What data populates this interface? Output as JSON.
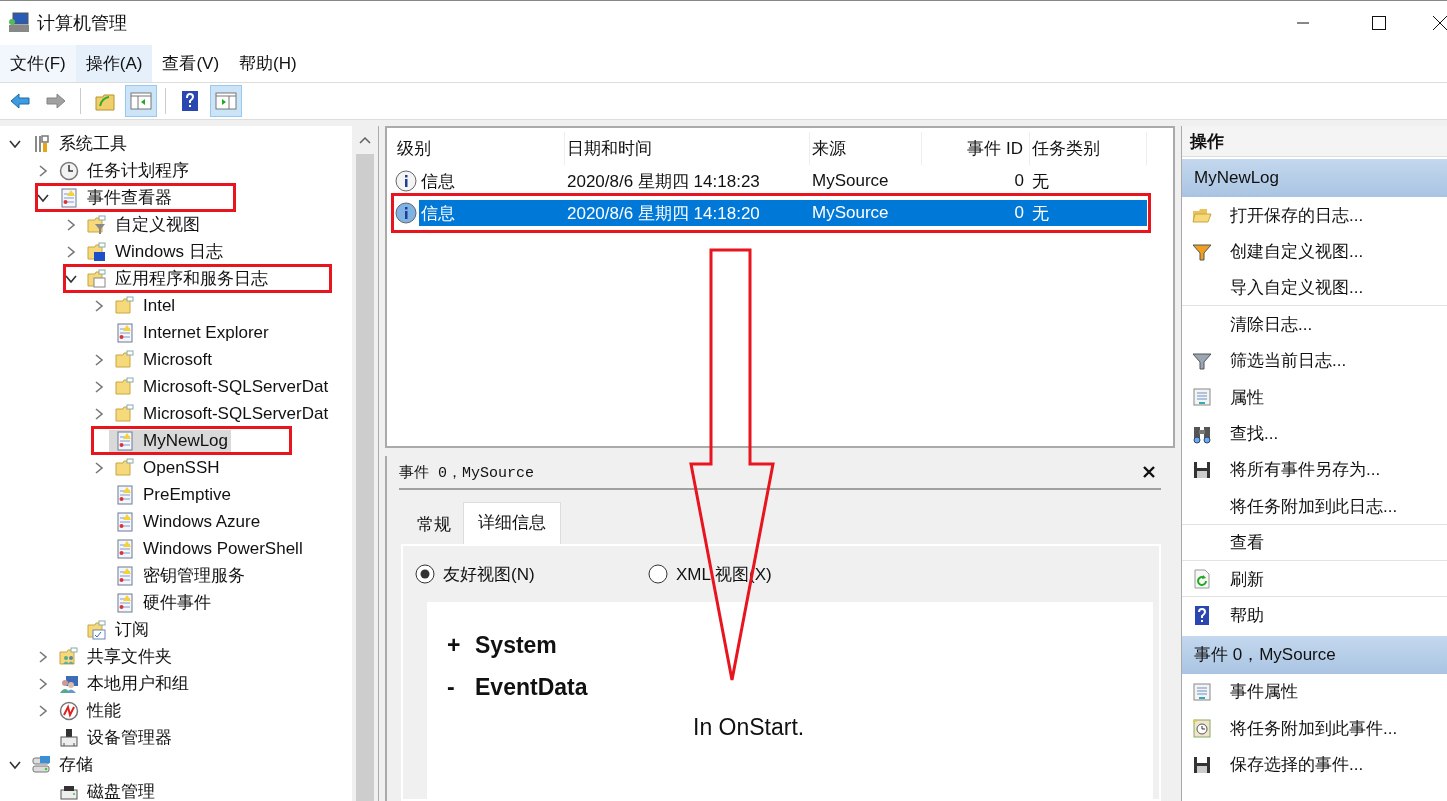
{
  "window": {
    "title": "计算机管理"
  },
  "menu": [
    {
      "label": "文件(F)",
      "selected": false
    },
    {
      "label": "操作(A)",
      "selected": true
    },
    {
      "label": "查看(V)",
      "selected": false
    },
    {
      "label": "帮助(H)",
      "selected": false
    }
  ],
  "toolbar": [
    {
      "kind": "back",
      "pressed": false,
      "disabled": false
    },
    {
      "kind": "forward",
      "pressed": false,
      "disabled": true
    },
    {
      "kind": "up",
      "pressed": false,
      "disabled": false
    },
    {
      "kind": "tree",
      "pressed": true,
      "disabled": false
    },
    {
      "kind": "help",
      "pressed": false,
      "disabled": false
    },
    {
      "kind": "actions",
      "pressed": true,
      "disabled": false
    }
  ],
  "tree": [
    {
      "label": "系统工具",
      "kind": "tools",
      "expandable": true,
      "expanded": true,
      "selected": false,
      "annotated": false,
      "children": [
        {
          "label": "任务计划程序",
          "kind": "clock",
          "expandable": true,
          "expanded": false,
          "selected": false,
          "annotated": false
        },
        {
          "label": "事件查看器",
          "kind": "viewer",
          "expandable": true,
          "expanded": true,
          "selected": false,
          "annotated": true,
          "children": [
            {
              "label": "自定义视图",
              "kind": "folder-filter",
              "expandable": true,
              "expanded": false,
              "selected": false,
              "annotated": false
            },
            {
              "label": "Windows 日志",
              "kind": "folder-win",
              "expandable": true,
              "expanded": false,
              "selected": false,
              "annotated": false
            },
            {
              "label": "应用程序和服务日志",
              "kind": "folder-app",
              "expandable": true,
              "expanded": true,
              "selected": false,
              "annotated": true,
              "children": [
                {
                  "label": "Intel",
                  "kind": "folder",
                  "expandable": true,
                  "expanded": false,
                  "selected": false,
                  "annotated": false
                },
                {
                  "label": "Internet Explorer",
                  "kind": "log",
                  "expandable": false,
                  "selected": false,
                  "annotated": false
                },
                {
                  "label": "Microsoft",
                  "kind": "folder",
                  "expandable": true,
                  "expanded": false,
                  "selected": false,
                  "annotated": false
                },
                {
                  "label": "Microsoft-SQLServerDat",
                  "kind": "folder",
                  "expandable": true,
                  "expanded": false,
                  "selected": false,
                  "annotated": false
                },
                {
                  "label": "Microsoft-SQLServerDat",
                  "kind": "folder",
                  "expandable": true,
                  "expanded": false,
                  "selected": false,
                  "annotated": false
                },
                {
                  "label": "MyNewLog",
                  "kind": "log",
                  "expandable": false,
                  "selected": true,
                  "annotated": true
                },
                {
                  "label": "OpenSSH",
                  "kind": "folder",
                  "expandable": true,
                  "expanded": false,
                  "selected": false,
                  "annotated": false
                },
                {
                  "label": "PreEmptive",
                  "kind": "log",
                  "expandable": false,
                  "selected": false,
                  "annotated": false
                },
                {
                  "label": "Windows Azure",
                  "kind": "log",
                  "expandable": false,
                  "selected": false,
                  "annotated": false
                },
                {
                  "label": "Windows PowerShell",
                  "kind": "log",
                  "expandable": false,
                  "selected": false,
                  "annotated": false
                },
                {
                  "label": "密钥管理服务",
                  "kind": "log",
                  "expandable": false,
                  "selected": false,
                  "annotated": false
                },
                {
                  "label": "硬件事件",
                  "kind": "log",
                  "expandable": false,
                  "selected": false,
                  "annotated": false
                }
              ]
            },
            {
              "label": "订阅",
              "kind": "subscription",
              "expandable": false,
              "selected": false,
              "annotated": false
            }
          ]
        },
        {
          "label": "共享文件夹",
          "kind": "share",
          "expandable": true,
          "expanded": false,
          "selected": false,
          "annotated": false
        },
        {
          "label": "本地用户和组",
          "kind": "users",
          "expandable": true,
          "expanded": false,
          "selected": false,
          "annotated": false
        },
        {
          "label": "性能",
          "kind": "perf",
          "expandable": true,
          "expanded": false,
          "selected": false,
          "annotated": false
        },
        {
          "label": "设备管理器",
          "kind": "device",
          "expandable": false,
          "selected": false,
          "annotated": false
        }
      ]
    },
    {
      "label": "存储",
      "kind": "storage",
      "expandable": true,
      "expanded": true,
      "selected": false,
      "annotated": false,
      "children": [
        {
          "label": "磁盘管理",
          "kind": "disk",
          "expandable": false,
          "selected": false,
          "annotated": false
        }
      ]
    }
  ],
  "table": {
    "columns": [
      "级别",
      "日期和时间",
      "来源",
      "事件 ID",
      "任务类别"
    ],
    "rows": [
      {
        "cells": [
          "信息",
          "2020/8/6 星期四 14:18:23",
          "MySource",
          "0",
          "无"
        ],
        "selected": false,
        "annotated": false
      },
      {
        "cells": [
          "信息",
          "2020/8/6 星期四 14:18:20",
          "MySource",
          "0",
          "无"
        ],
        "selected": true,
        "annotated": true
      }
    ]
  },
  "detail": {
    "title": "事件 0，MySource",
    "tabs": [
      {
        "label": "常规",
        "selected": false
      },
      {
        "label": "详细信息",
        "selected": true
      }
    ],
    "views": [
      {
        "label": "友好视图(N)",
        "selected": true
      },
      {
        "label": "XML 视图(X)",
        "selected": false
      }
    ],
    "sections": [
      {
        "toggle": "+",
        "label": "System"
      },
      {
        "toggle": "-",
        "label": "EventData",
        "lines": [
          "In OnStart."
        ]
      }
    ]
  },
  "actions": {
    "title": "操作",
    "groups": [
      {
        "title": "MyNewLog",
        "items": [
          {
            "label": "打开保存的日志...",
            "kind": "open",
            "separator_after": false
          },
          {
            "label": "创建自定义视图...",
            "kind": "filter-new",
            "separator_after": false
          },
          {
            "label": "导入自定义视图...",
            "kind": "none",
            "separator_after": true
          },
          {
            "label": "清除日志...",
            "kind": "none",
            "separator_after": false
          },
          {
            "label": "筛选当前日志...",
            "kind": "filter",
            "separator_after": false
          },
          {
            "label": "属性",
            "kind": "properties",
            "separator_after": false
          },
          {
            "label": "查找...",
            "kind": "find",
            "separator_after": false
          },
          {
            "label": "将所有事件另存为...",
            "kind": "save",
            "separator_after": false
          },
          {
            "label": "将任务附加到此日志...",
            "kind": "none",
            "separator_after": true
          },
          {
            "label": "查看",
            "kind": "none",
            "separator_after": true
          },
          {
            "label": "刷新",
            "kind": "refresh",
            "separator_after": true
          },
          {
            "label": "帮助",
            "kind": "help",
            "separator_after": false
          }
        ]
      },
      {
        "title": "事件 0，MySource",
        "items": [
          {
            "label": "事件属性",
            "kind": "properties",
            "separator_after": false
          },
          {
            "label": "将任务附加到此事件...",
            "kind": "task",
            "separator_after": false
          },
          {
            "label": "保存选择的事件...",
            "kind": "save",
            "separator_after": false
          }
        ]
      }
    ]
  }
}
